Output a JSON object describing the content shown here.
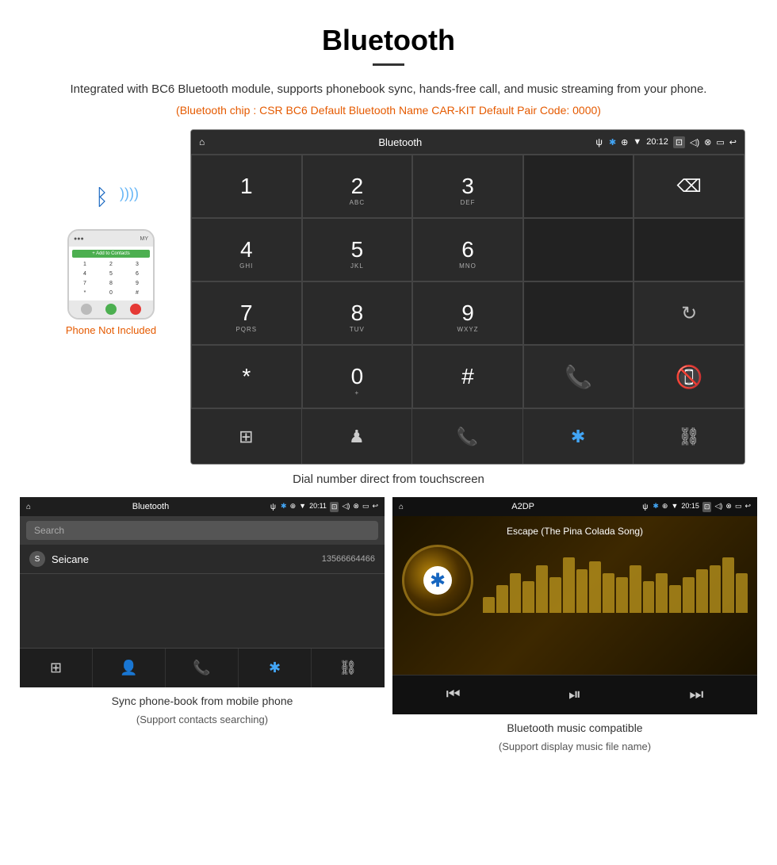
{
  "page": {
    "title": "Bluetooth",
    "title_divider": true,
    "description": "Integrated with BC6 Bluetooth module, supports phonebook sync, hands-free call, and music streaming from your phone.",
    "specs": "(Bluetooth chip : CSR BC6    Default Bluetooth Name CAR-KIT    Default Pair Code: 0000)"
  },
  "phone_illustration": {
    "bluetooth_icon": "ᛒ",
    "not_included_label": "Phone Not Included",
    "phone_keys": [
      "1",
      "2",
      "3",
      "4",
      "5",
      "6",
      "7",
      "8",
      "9",
      "*",
      "0",
      "#"
    ],
    "add_contacts": "+ Add to Contacts"
  },
  "dial_screen": {
    "status_bar": {
      "home_icon": "⌂",
      "title": "Bluetooth",
      "usb_icon": "ψ",
      "bt_icon": "✱",
      "location_icon": "⊕",
      "signal_icon": "▼",
      "time": "20:12",
      "camera_icon": "⊡",
      "vol_icon": "◁)",
      "close_icon": "⊗",
      "window_icon": "▭",
      "back_icon": "↩"
    },
    "keys": [
      {
        "main": "1",
        "sub": ""
      },
      {
        "main": "2",
        "sub": "ABC"
      },
      {
        "main": "3",
        "sub": "DEF"
      },
      {
        "main": "",
        "sub": ""
      },
      {
        "main": "⌫",
        "sub": "",
        "type": "backspace"
      },
      {
        "main": "4",
        "sub": "GHI"
      },
      {
        "main": "5",
        "sub": "JKL"
      },
      {
        "main": "6",
        "sub": "MNO"
      },
      {
        "main": "",
        "sub": ""
      },
      {
        "main": "",
        "sub": ""
      },
      {
        "main": "7",
        "sub": "PQRS"
      },
      {
        "main": "8",
        "sub": "TUV"
      },
      {
        "main": "9",
        "sub": "WXYZ"
      },
      {
        "main": "",
        "sub": ""
      },
      {
        "main": "↻",
        "sub": "",
        "type": "refresh"
      },
      {
        "main": "*",
        "sub": ""
      },
      {
        "main": "0",
        "sub": "+",
        "type": "zero"
      },
      {
        "main": "#",
        "sub": ""
      },
      {
        "main": "📞",
        "sub": "",
        "type": "green"
      },
      {
        "main": "📵",
        "sub": "",
        "type": "red"
      }
    ],
    "toolbar_icons": [
      "⊞",
      "♟",
      "📞",
      "✱",
      "⛓"
    ]
  },
  "main_caption": "Dial number direct from touchscreen",
  "phonebook_screen": {
    "status_bar": {
      "home_icon": "⌂",
      "title": "Bluetooth",
      "usb_icon": "ψ",
      "bt_icon": "✱",
      "location_icon": "⊕",
      "signal_icon": "▼",
      "time": "20:11",
      "camera_icon": "⊡",
      "vol_icon": "◁)",
      "close_icon": "⊗",
      "window_icon": "▭",
      "back_icon": "↩"
    },
    "search_placeholder": "Search",
    "contacts": [
      {
        "initial": "S",
        "name": "Seicane",
        "number": "13566664466"
      }
    ],
    "toolbar_icons": [
      "⊞",
      "👤",
      "📞",
      "✱",
      "⛓"
    ]
  },
  "phonebook_caption": "Sync phone-book from mobile phone",
  "phonebook_caption_sub": "(Support contacts searching)",
  "music_screen": {
    "status_bar": {
      "home_icon": "⌂",
      "title": "A2DP",
      "usb_icon": "ψ",
      "bt_icon": "✱",
      "location_icon": "⊕",
      "signal_icon": "▼",
      "time": "20:15",
      "camera_icon": "⊡",
      "vol_icon": "◁)",
      "close_icon": "⊗",
      "window_icon": "▭",
      "back_icon": "↩"
    },
    "song_title": "Escape (The Pina Colada Song)",
    "eq_bars": [
      20,
      35,
      50,
      40,
      60,
      45,
      70,
      55,
      65,
      50,
      45,
      60,
      40,
      50,
      35,
      45,
      55,
      60,
      70,
      50
    ],
    "controls": [
      "⏮",
      "⏯",
      "⏭"
    ]
  },
  "music_caption": "Bluetooth music compatible",
  "music_caption_sub": "(Support display music file name)"
}
